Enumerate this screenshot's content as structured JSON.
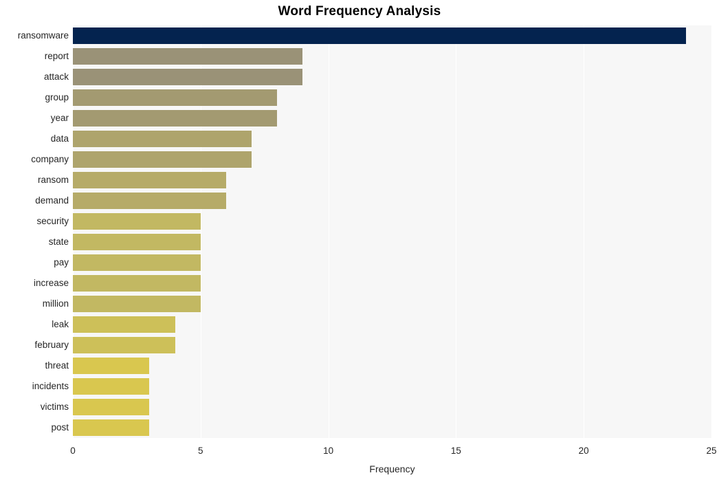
{
  "chart_data": {
    "type": "bar",
    "orientation": "horizontal",
    "title": "Word Frequency Analysis",
    "xlabel": "Frequency",
    "ylabel": "",
    "xlim": [
      0,
      25
    ],
    "xticks": [
      "0",
      "5",
      "10",
      "15",
      "20",
      "25"
    ],
    "xtick_values": [
      0,
      5,
      10,
      15,
      20,
      25
    ],
    "grid": "vertical-white-on-light-gray",
    "legend": "none",
    "categories": [
      "ransomware",
      "report",
      "attack",
      "group",
      "year",
      "data",
      "company",
      "ransom",
      "demand",
      "security",
      "state",
      "pay",
      "increase",
      "million",
      "leak",
      "february",
      "threat",
      "incidents",
      "victims",
      "post"
    ],
    "values": [
      24,
      9,
      9,
      8,
      8,
      7,
      7,
      6,
      6,
      5,
      5,
      5,
      5,
      5,
      4,
      4,
      3,
      3,
      3,
      3
    ],
    "bar_colors": [
      "#04234f",
      "#9a9277",
      "#9a9277",
      "#a39a71",
      "#a39a71",
      "#aea46c",
      "#aea46c",
      "#b6ab68",
      "#b6ab68",
      "#c2b862",
      "#c2b862",
      "#c2b862",
      "#c2b862",
      "#c2b862",
      "#cdc059",
      "#cdc059",
      "#d9c74f",
      "#d9c74f",
      "#d9c74f",
      "#d9c74f"
    ]
  },
  "colors": {
    "plot_background": "#f7f7f7",
    "page_background": "#ffffff",
    "gridline": "#ffffff",
    "text": "#262626",
    "title": "#000000",
    "highlight_bar": "#04234f"
  }
}
